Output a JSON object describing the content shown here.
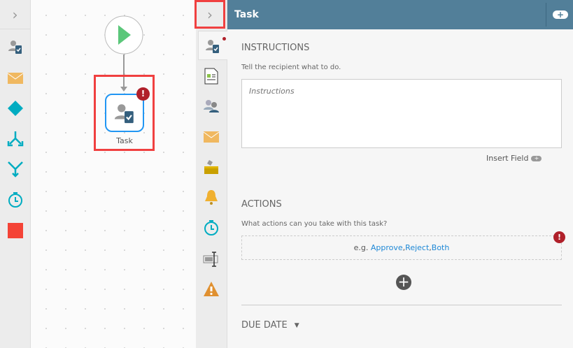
{
  "canvas": {
    "node_label": "Task"
  },
  "panel": {
    "title": "Task",
    "instructions": {
      "heading": "INSTRUCTIONS",
      "hint": "Tell the recipient what to do.",
      "placeholder": "Instructions",
      "value": "",
      "insert_field": "Insert Field"
    },
    "actions": {
      "heading": "ACTIONS",
      "hint": "What actions can you take with this task?",
      "example_prefix": "e.g.",
      "examples": [
        "Approve",
        "Reject",
        "Both"
      ],
      "sep1": ", ",
      "sep2": ", "
    },
    "due_date": {
      "heading": "DUE DATE"
    }
  },
  "colors": {
    "header": "#527f99",
    "error": "#b0202a",
    "link": "#1e88d6",
    "highlight": "#f04040"
  }
}
